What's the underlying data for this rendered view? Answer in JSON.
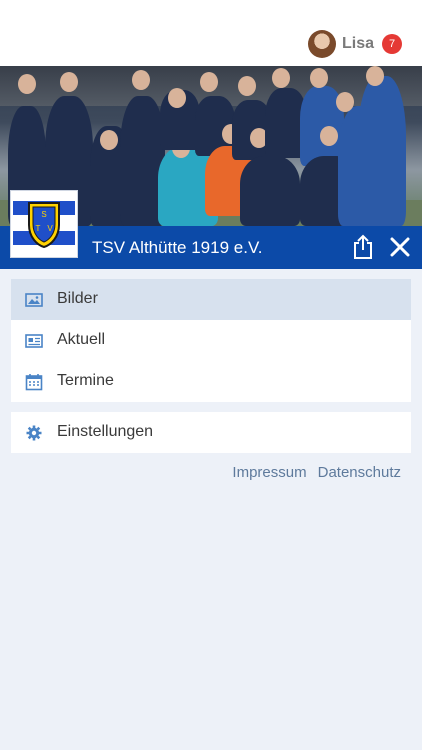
{
  "user": {
    "name": "Lisa",
    "notification_count": "7"
  },
  "club": {
    "title": "TSV Althütte 1919 e.V.",
    "logo_text": "TSV"
  },
  "menu_groups": [
    [
      {
        "label": "Bilder",
        "icon": "image-icon",
        "active": true
      },
      {
        "label": "Aktuell",
        "icon": "news-icon",
        "active": false
      },
      {
        "label": "Termine",
        "icon": "calendar-icon",
        "active": false
      }
    ],
    [
      {
        "label": "Einstellungen",
        "icon": "gear-icon",
        "active": false
      }
    ]
  ],
  "footer_links": [
    "Impressum",
    "Datenschutz"
  ],
  "colors": {
    "brand_blue": "#0c4aa8",
    "active_item": "#d7e1ee",
    "badge_red": "#e53935",
    "link": "#5e7a9c"
  }
}
